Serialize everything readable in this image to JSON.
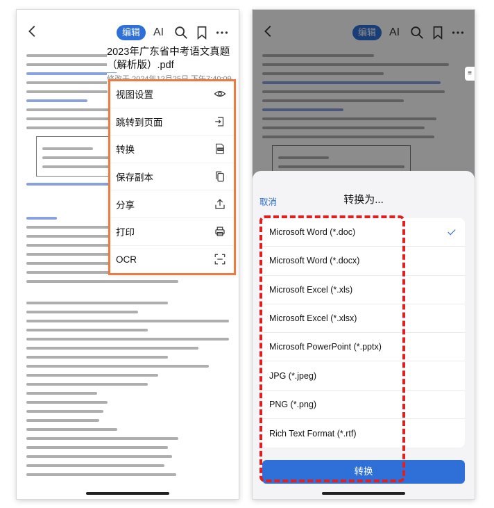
{
  "colors": {
    "accent": "#2f6fd8",
    "menu_highlight": "#ec7b3f",
    "frame_highlight": "#e02020"
  },
  "left": {
    "toolbar": {
      "back_icon": "chevron-left-icon",
      "edit_label": "编辑",
      "ai_label": "AI",
      "search_icon": "search-icon",
      "bookmark_icon": "bookmark-icon",
      "more_icon": "more-icon"
    },
    "file": {
      "title": "2023年广东省中考语文真题（解析版）.pdf",
      "modified": "修改于 2024年12月25日 下午7:40:09"
    },
    "menu": [
      {
        "label": "视图设置",
        "icon": "eye-icon"
      },
      {
        "label": "跳转到页面",
        "icon": "jump-page-icon"
      },
      {
        "label": "转换",
        "icon": "convert-pdf-icon"
      },
      {
        "label": "保存副本",
        "icon": "copy-icon"
      },
      {
        "label": "分享",
        "icon": "share-icon"
      },
      {
        "label": "打印",
        "icon": "print-icon"
      },
      {
        "label": "OCR",
        "icon": "ocr-scan-icon"
      }
    ]
  },
  "right": {
    "toolbar": {
      "edit_label": "编辑",
      "ai_label": "AI"
    },
    "sheet": {
      "cancel_label": "取消",
      "title": "转换为...",
      "options": [
        {
          "label": "Microsoft Word (*.doc)",
          "selected": true
        },
        {
          "label": "Microsoft Word (*.docx)",
          "selected": false
        },
        {
          "label": "Microsoft Excel (*.xls)",
          "selected": false
        },
        {
          "label": "Microsoft Excel (*.xlsx)",
          "selected": false
        },
        {
          "label": "Microsoft PowerPoint (*.pptx)",
          "selected": false
        },
        {
          "label": "JPG (*.jpeg)",
          "selected": false
        },
        {
          "label": "PNG (*.png)",
          "selected": false
        },
        {
          "label": "Rich Text Format (*.rtf)",
          "selected": false
        }
      ],
      "convert_label": "转换"
    }
  }
}
